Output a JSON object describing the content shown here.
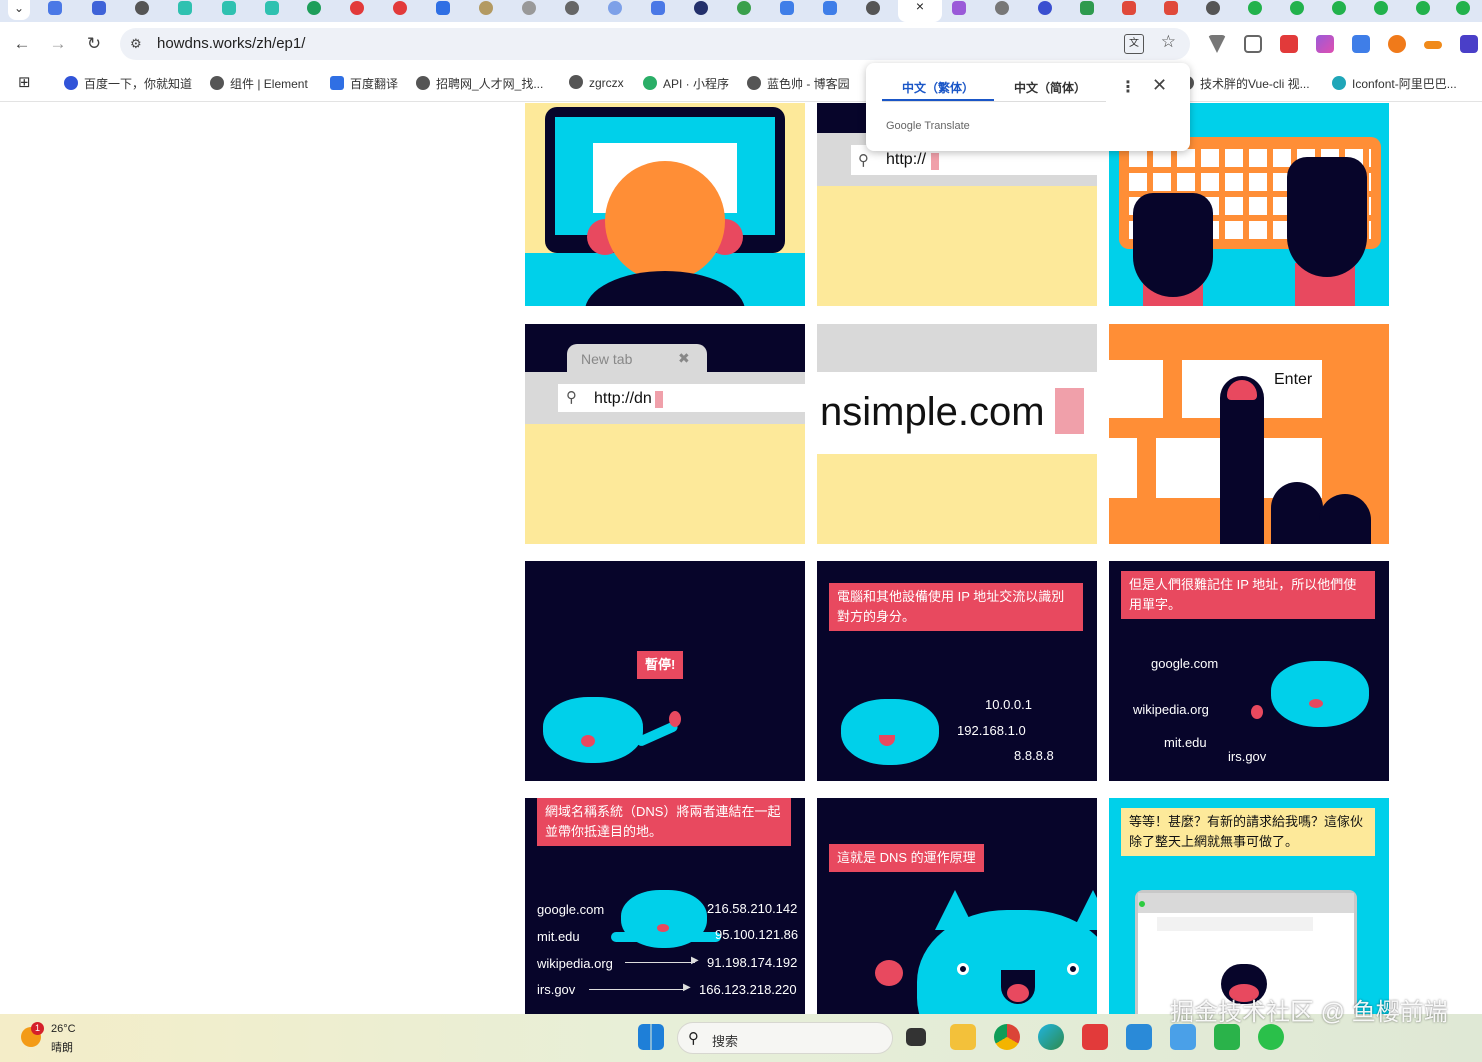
{
  "browser": {
    "active_tab_close": "×",
    "url": "howdns.works/zh/ep1/"
  },
  "bookmarks": [
    {
      "label": "百度一下，你就知道",
      "color": "#3154d8"
    },
    {
      "label": "组件 | Element",
      "color": "#555555"
    },
    {
      "label": "百度翻译",
      "color": "#2f6fe4"
    },
    {
      "label": "招聘网_人才网_找...",
      "color": "#555555"
    },
    {
      "label": "zgrczx",
      "color": "#555555"
    },
    {
      "label": "API · 小程序",
      "color": "#2aae67"
    },
    {
      "label": "蓝色帅 - 博客园",
      "color": "#555555"
    },
    {
      "label": "技术胖的Vue-cli 视...",
      "color": "#555555"
    },
    {
      "label": "Iconfont-阿里巴巴...",
      "color": "#1fa6b8"
    }
  ],
  "translate_popup": {
    "tab_traditional": "中文（繁体）",
    "tab_simplified": "中文（简体）",
    "more": "⋮",
    "close": "✕",
    "brand": "Google Translate"
  },
  "comic": {
    "url_partial_1": "http://",
    "new_tab_label": "New tab",
    "url_partial_2": "http://dn",
    "domain_big": "nsimple.com",
    "enter_key": "Enter",
    "pause": "暫停!",
    "ip_intro": "電腦和其他設備使用 IP 地址交流以識別對方的身分。",
    "ips": [
      "10.0.0.1",
      "192.168.1.0",
      "8.8.8.8"
    ],
    "hard_to_remember": "但是人們很難記住 IP 地址，所以他們使用單字。",
    "domains": [
      "google.com",
      "wikipedia.org",
      "mit.edu",
      "irs.gov"
    ],
    "dns_connects": "網域名稱系統（DNS）將兩者連結在一起並帶你抵達目的地。",
    "mapping": [
      {
        "domain": "google.com",
        "ip": "216.58.210.142"
      },
      {
        "domain": "mit.edu",
        "ip": "95.100.121.86"
      },
      {
        "domain": "wikipedia.org",
        "ip": "91.198.174.192"
      },
      {
        "domain": "irs.gov",
        "ip": "166.123.218.220"
      }
    ],
    "how_dns_works": "這就是 DNS 的運作原理",
    "wait_new_request": "等等！甚麼？有新的請求給我嗎？這傢伙除了整天上網就無事可做了。"
  },
  "taskbar": {
    "weather_badge": "1",
    "temperature": "26°C",
    "weather": "晴朗",
    "search_placeholder": "搜索"
  },
  "watermark": "掘金技术社区 @ 鱼樱前端",
  "colors": {
    "tabstrip": "#dfe7f5",
    "comic_navy": "#07052a",
    "comic_cyan": "#00d0ea",
    "comic_yellow": "#fde99a",
    "comic_orange": "#ff8e36",
    "comic_red": "#e8495f",
    "comic_gray": "#d9d9d9"
  }
}
